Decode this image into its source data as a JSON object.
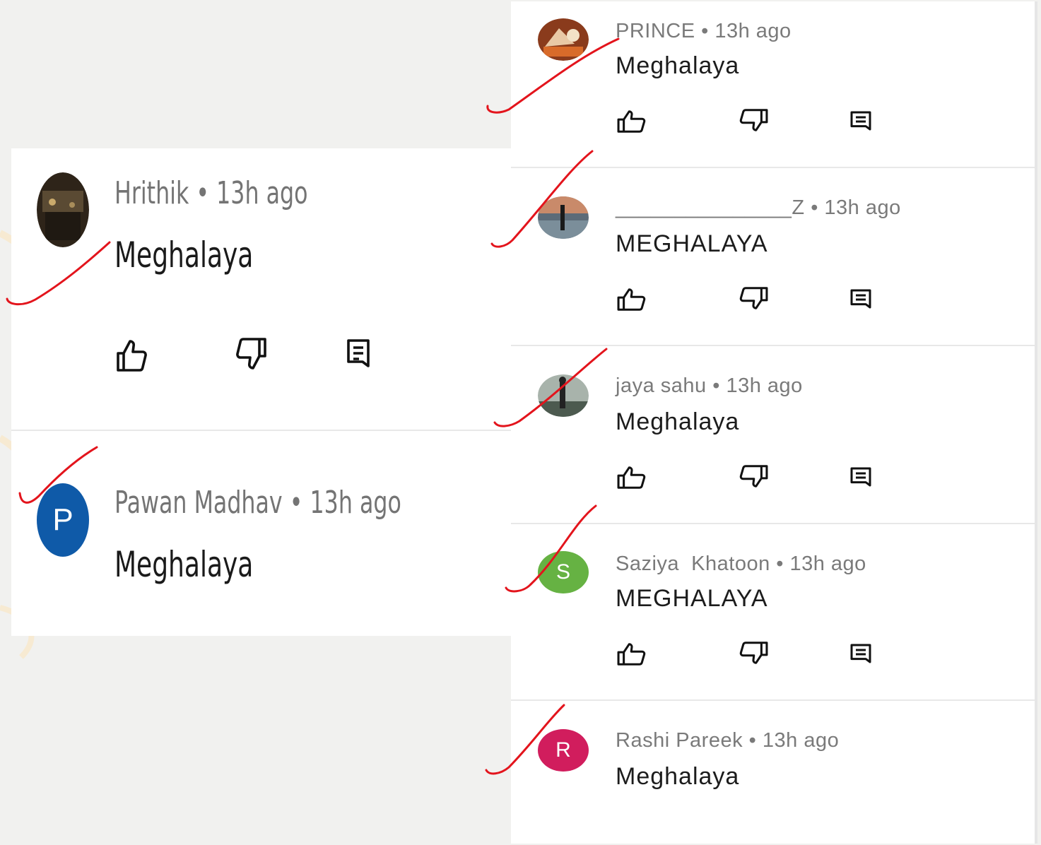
{
  "comments_left": [
    {
      "author": "Hrithik",
      "sep": "•",
      "time": "13h ago",
      "text": "Meghalaya",
      "avatar_type": "photo",
      "avatar_color": "#3b2f22"
    },
    {
      "author": "Pawan Madhav",
      "sep": "•",
      "time": "13h ago",
      "text": "Meghalaya",
      "avatar_type": "letter",
      "avatar_letter": "P",
      "avatar_color": "#0f5aa8"
    }
  ],
  "comments_right": [
    {
      "author": "PRINCE",
      "sep": "•",
      "time": "13h ago",
      "text": "Meghalaya",
      "avatar_type": "photo",
      "avatar_color": "#b85a2a"
    },
    {
      "author": "_______________Z",
      "sep": "•",
      "time": "13h ago",
      "text": "MEGHALAYA",
      "avatar_type": "photo",
      "avatar_color": "#4a5a6a"
    },
    {
      "author": "jaya sahu",
      "sep": "•",
      "time": "13h ago",
      "text": "Meghalaya",
      "avatar_type": "photo",
      "avatar_color": "#6f7a72"
    },
    {
      "author": "Saziya  Khatoon",
      "sep": "•",
      "time": "13h ago",
      "text": "MEGHALAYA",
      "avatar_type": "letter",
      "avatar_letter": "S",
      "avatar_color": "#66b243"
    },
    {
      "author": "Rashi Pareek",
      "sep": "•",
      "time": "13h ago",
      "text": "Meghalaya",
      "avatar_type": "letter",
      "avatar_letter": "R",
      "avatar_color": "#d11d5d"
    }
  ],
  "icons": {
    "like": "thumbs-up-icon",
    "dislike": "thumbs-down-icon",
    "reply": "reply-comment-icon"
  },
  "colors": {
    "annotation_ink": "#e3141c",
    "page_bg": "#f1f1ef",
    "card_bg": "#ffffff"
  }
}
